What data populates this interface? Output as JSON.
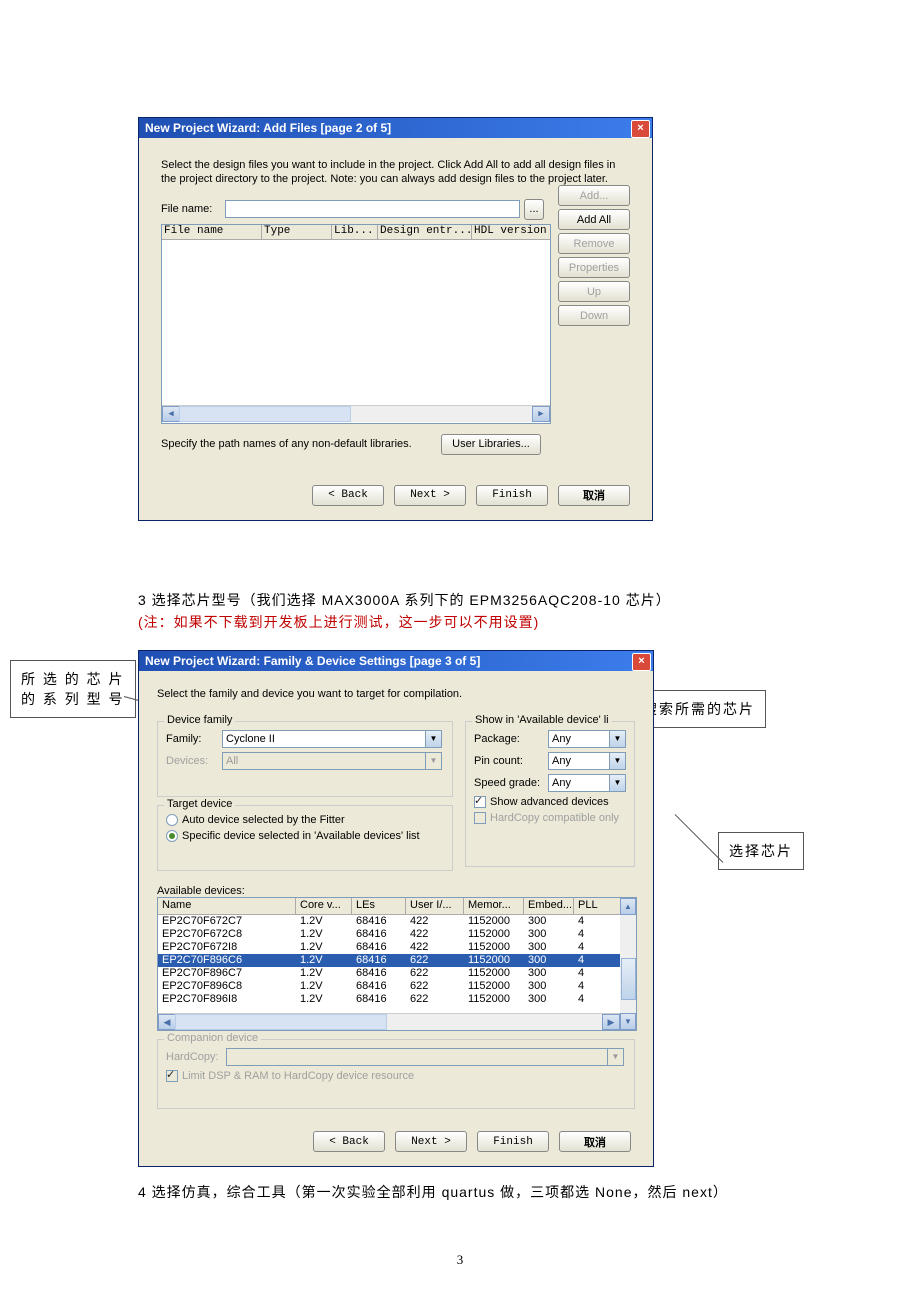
{
  "dialog1": {
    "title": "New Project Wizard: Add Files [page 2 of 5]",
    "desc": "Select the design files you want to include in the project. Click Add All to add all design files in the project directory to the project. Note: you can always add design files to the project later.",
    "fileNameLabel": "File name:",
    "browse": "...",
    "cols": {
      "file": "File name",
      "type": "Type",
      "lib": "Lib...",
      "entry": "Design entr...",
      "hdl": "HDL version"
    },
    "btns": {
      "add": "Add...",
      "addAll": "Add All",
      "remove": "Remove",
      "props": "Properties",
      "up": "Up",
      "down": "Down"
    },
    "specify": "Specify the path names of any non-default libraries.",
    "userLib": "User Libraries...",
    "nav": {
      "back": "< Back",
      "next": "Next >",
      "finish": "Finish",
      "cancel": "取消"
    }
  },
  "doc": {
    "step3": "3  选择芯片型号（我们选择 MAX3000A 系列下的 EPM3256AQC208-10 芯片）",
    "note": "(注：如果不下载到开发板上进行测试，这一步可以不用设置)",
    "step4": "4  选择仿真，综合工具（第一次实验全部利用 quartus 做，三项都选 None，然后 next）",
    "page": "3"
  },
  "callouts": {
    "c1a": "所 选 的 芯 片",
    "c1b": "的 系 列 型 号",
    "c2": "快速搜索所需的芯片",
    "c3": "选择芯片"
  },
  "dialog2": {
    "title": "New Project Wizard: Family & Device Settings [page 3 of 5]",
    "desc": "Select the family and device you want to target for compilation.",
    "deviceFamily": "Device family",
    "familyLabel": "Family:",
    "familyVal": "Cyclone II",
    "devicesLabel": "Devices:",
    "devicesVal": "All",
    "target": "Target device",
    "rAuto": "Auto device selected by the Fitter",
    "rSpecific": "Specific device selected in 'Available devices' list",
    "showIn": "Show in 'Available device' li",
    "pkgLabel": "Package:",
    "pkgVal": "Any",
    "pinLabel": "Pin count:",
    "pinVal": "Any",
    "spdLabel": "Speed grade:",
    "spdVal": "Any",
    "showAdv": "Show advanced devices",
    "hardOnly": "HardCopy compatible only",
    "avail": "Available devices:",
    "head": {
      "name": "Name",
      "core": "Core v...",
      "les": "LEs",
      "user": "User I/...",
      "mem": "Memor...",
      "emb": "Embed...",
      "pll": "PLL"
    },
    "rows": [
      {
        "name": "EP2C70F672C7",
        "core": "1.2V",
        "les": "68416",
        "user": "422",
        "mem": "1152000",
        "emb": "300",
        "pll": "4",
        "sel": false
      },
      {
        "name": "EP2C70F672C8",
        "core": "1.2V",
        "les": "68416",
        "user": "422",
        "mem": "1152000",
        "emb": "300",
        "pll": "4",
        "sel": false
      },
      {
        "name": "EP2C70F672I8",
        "core": "1.2V",
        "les": "68416",
        "user": "422",
        "mem": "1152000",
        "emb": "300",
        "pll": "4",
        "sel": false
      },
      {
        "name": "EP2C70F896C6",
        "core": "1.2V",
        "les": "68416",
        "user": "622",
        "mem": "1152000",
        "emb": "300",
        "pll": "4",
        "sel": true
      },
      {
        "name": "EP2C70F896C7",
        "core": "1.2V",
        "les": "68416",
        "user": "622",
        "mem": "1152000",
        "emb": "300",
        "pll": "4",
        "sel": false
      },
      {
        "name": "EP2C70F896C8",
        "core": "1.2V",
        "les": "68416",
        "user": "622",
        "mem": "1152000",
        "emb": "300",
        "pll": "4",
        "sel": false
      },
      {
        "name": "EP2C70F896I8",
        "core": "1.2V",
        "les": "68416",
        "user": "622",
        "mem": "1152000",
        "emb": "300",
        "pll": "4",
        "sel": false
      }
    ],
    "companion": "Companion device",
    "hardCopyLabel": "HardCopy:",
    "limit": "Limit DSP & RAM to HardCopy device resource",
    "nav": {
      "back": "< Back",
      "next": "Next >",
      "finish": "Finish",
      "cancel": "取消"
    }
  }
}
